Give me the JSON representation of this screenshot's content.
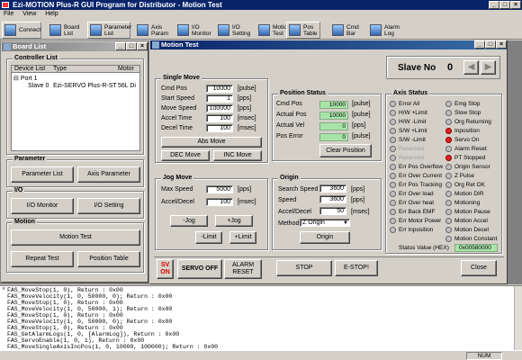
{
  "app_title": "Ezi-MOTION Plus-R GUI Program for Distributor - Motion Test",
  "menu": [
    "File",
    "View",
    "Help"
  ],
  "toolbar": [
    {
      "label": "Connect"
    },
    {
      "label": "Board\nList"
    },
    {
      "label": "Parameter\nList"
    },
    {
      "label": "Axis\nParam"
    },
    {
      "label": "I/O\nMonitor"
    },
    {
      "label": "I/O\nSetting"
    },
    {
      "label": "Motion\nTest"
    },
    {
      "label": "Pos\nTable"
    },
    {
      "label": "Cmd\nBar"
    },
    {
      "label": "Alarm\nLog"
    }
  ],
  "board_list": {
    "title": "Board List",
    "controller_group": "Controller List",
    "columns": [
      "Device List",
      "Type",
      "Motor"
    ],
    "port": "Port 1",
    "slave": {
      "name": "Slave 0",
      "type": "Ezi-SERVO Plus-R-ST",
      "motor": "56L Di"
    },
    "parameter_group": "Parameter",
    "parameter_list": "Parameter List",
    "axis_parameter": "Axis Parameter",
    "io_group": "I/O",
    "io_monitor": "I/O Monitor",
    "io_setting": "I/O Setting",
    "motion_group": "Motion",
    "motion_test": "Motion Test",
    "repeat_test": "Repeat Test",
    "position_table": "Position Table"
  },
  "motion_test": {
    "title": "Motion Test",
    "slave_label": "Slave No",
    "slave_no": "0",
    "single_move": {
      "title": "Single Move",
      "fields": [
        {
          "label": "Cmd Pos",
          "value": "10000",
          "unit": "[pulse]"
        },
        {
          "label": "Start Speed",
          "value": "1",
          "unit": "[pps]"
        },
        {
          "label": "Move Speed",
          "value": "100000",
          "unit": "[pps]"
        },
        {
          "label": "Accel Time",
          "value": "100",
          "unit": "[msec]"
        },
        {
          "label": "Decel Time",
          "value": "100",
          "unit": "[msec]"
        }
      ],
      "abs_move": "Abs Move",
      "dec_move": "DEC Move",
      "inc_move": "INC Move"
    },
    "position_status": {
      "title": "Position Status",
      "fields": [
        {
          "label": "Cmd Pos",
          "value": "10000",
          "unit": "[pulse]"
        },
        {
          "label": "Actual Pos",
          "value": "10000",
          "unit": "[pulse]"
        },
        {
          "label": "Actual Vel",
          "value": "0",
          "unit": "[pps]"
        },
        {
          "label": "Pos Error",
          "value": "0",
          "unit": "[pulse]"
        }
      ],
      "clear": "Clear Position"
    },
    "jog_move": {
      "title": "Jog Move",
      "fields": [
        {
          "label": "Max Speed",
          "value": "5000",
          "unit": "[pps]"
        },
        {
          "label": "Accel/Decel",
          "value": "100",
          "unit": "[msec]"
        }
      ],
      "neg_jog": "-Jog",
      "pos_jog": "+Jog",
      "neg_limit": "-Limit",
      "pos_limit": "+Limit"
    },
    "origin": {
      "title": "Origin",
      "fields": [
        {
          "label": "Search Speed",
          "value": "3600",
          "unit": "[pps]"
        },
        {
          "label": "Speed",
          "value": "3600",
          "unit": "[pps]"
        },
        {
          "label": "Accel/Decel",
          "value": "50",
          "unit": "[msec]"
        }
      ],
      "method_label": "Method",
      "method_value": "Z Origin",
      "origin_btn": "Origin"
    },
    "axis_status": {
      "title": "Axis Status",
      "left": [
        {
          "label": "Error All",
          "on": false,
          "dim": false
        },
        {
          "label": "H/W +Limit",
          "on": false,
          "dim": false
        },
        {
          "label": "H/W -Limit",
          "on": false,
          "dim": false
        },
        {
          "label": "S/W +Limit",
          "on": false,
          "dim": false
        },
        {
          "label": "S/W -Limit",
          "on": false,
          "dim": false
        },
        {
          "label": "Reserved",
          "on": false,
          "dim": true
        },
        {
          "label": "Reserved",
          "on": false,
          "dim": true
        },
        {
          "label": "Err Pos Overflow",
          "on": false,
          "dim": false
        },
        {
          "label": "Err Over Current",
          "on": false,
          "dim": false
        },
        {
          "label": "Err Pos Tracking",
          "on": false,
          "dim": false
        },
        {
          "label": "Err Over load",
          "on": false,
          "dim": false
        },
        {
          "label": "Err Over heat",
          "on": false,
          "dim": false
        },
        {
          "label": "Err Back EMF",
          "on": false,
          "dim": false
        },
        {
          "label": "Err Motor Power",
          "on": false,
          "dim": false
        },
        {
          "label": "Err Inposition",
          "on": false,
          "dim": false
        }
      ],
      "right": [
        {
          "label": "Emg Stop",
          "on": false
        },
        {
          "label": "Slow Stop",
          "on": false
        },
        {
          "label": "Org Returning",
          "on": false
        },
        {
          "label": "Inposition",
          "on": true
        },
        {
          "label": "Servo On",
          "on": true
        },
        {
          "label": "Alarm Reset",
          "on": false
        },
        {
          "label": "PT Stopped",
          "on": true
        },
        {
          "label": "Origin Sensor",
          "on": false
        },
        {
          "label": "Z Pulse",
          "on": false
        },
        {
          "label": "Org Ret OK",
          "on": false
        },
        {
          "label": "Motion DIR",
          "on": false
        },
        {
          "label": "Motioning",
          "on": false
        },
        {
          "label": "Motion Pause",
          "on": false
        },
        {
          "label": "Motion Accel",
          "on": false
        },
        {
          "label": "Motion Decel",
          "on": false
        },
        {
          "label": "Motion Constant",
          "on": false
        }
      ],
      "hex_label": "Status Value (HEX)",
      "hex_value": "0x00580000"
    },
    "bottom": {
      "sv_on": "SV\nON",
      "servo_off": "SERVO OFF",
      "alarm_reset": "ALARM\nRESET",
      "stop": "STOP",
      "estop": "E-STOP!",
      "close": "Close"
    }
  },
  "console_lines": [
    "FAS_MoveStop(1, 0), Return : 0x00",
    "FAS_MoveVelocity(1, 0, 50000, 0); Return : 0x00",
    "FAS_MoveStop(1, 0), Return : 0x00",
    "FAS_MoveVelocity(1, 0, 50000, 1); Return : 0x00",
    "FAS_MoveStop(1, 0), Return : 0x00",
    "FAS_MoveVelocity(1, 0, 50000, 0); Return : 0x00",
    "FAS_MoveStop(1, 0), Return : 0x00",
    "FAS_GetAlarmLogs(1, 0, [AlarmLog]), Return : 0x00",
    "FAS_ServoEnable(1, 0, 1), Return : 0x00",
    "FAS_MoveSingleAxisIncPos(1, 0, 10000, 100000); Return : 0x00"
  ],
  "status_indicator": "NUM",
  "colors": {
    "title": "#0a246a",
    "green_field": "#a8e4a8",
    "led_on": "#e02020"
  }
}
